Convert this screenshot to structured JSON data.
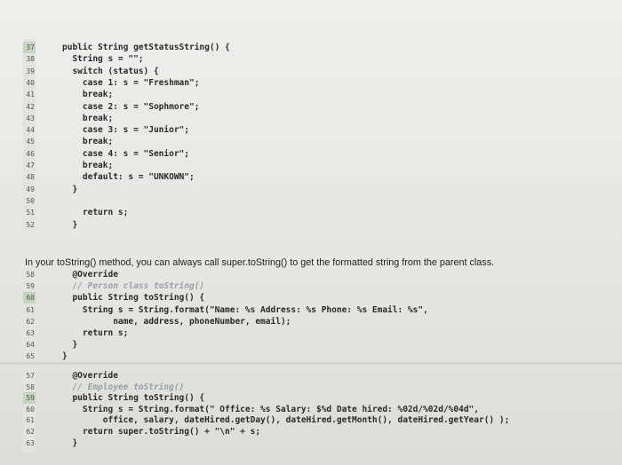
{
  "caption": "In your toString() method, you can always call super.toString() to get the formatted string from the parent class.",
  "block1": [
    {
      "n": "37",
      "code": "public String getStatusString() {"
    },
    {
      "n": "38",
      "code": "  String s = \"\";"
    },
    {
      "n": "39",
      "code": "  switch (status) {"
    },
    {
      "n": "40",
      "code": "    case 1: s = \"Freshman\";"
    },
    {
      "n": "41",
      "code": "    break;"
    },
    {
      "n": "42",
      "code": "    case 2: s = \"Sophmore\";"
    },
    {
      "n": "43",
      "code": "    break;"
    },
    {
      "n": "44",
      "code": "    case 3: s = \"Junior\";"
    },
    {
      "n": "45",
      "code": "    break;"
    },
    {
      "n": "46",
      "code": "    case 4: s = \"Senior\";"
    },
    {
      "n": "47",
      "code": "    break;"
    },
    {
      "n": "48",
      "code": "    default: s = \"UNKOWN\";"
    },
    {
      "n": "49",
      "code": "  }"
    },
    {
      "n": "50",
      "code": ""
    },
    {
      "n": "51",
      "code": "    return s;"
    },
    {
      "n": "52",
      "code": "  }"
    }
  ],
  "block2": [
    {
      "n": "58",
      "code": "  @Override"
    },
    {
      "n": "59",
      "code": "  // Person class toString()"
    },
    {
      "n": "60",
      "code": "  public String toString() {"
    },
    {
      "n": "61",
      "code": "    String s = String.format(\"Name: %s Address: %s Phone: %s Email: %s\","
    },
    {
      "n": "62",
      "code": "          name, address, phoneNumber, email);"
    },
    {
      "n": "63",
      "code": "    return s;"
    },
    {
      "n": "64",
      "code": "  }"
    },
    {
      "n": "65",
      "code": "}"
    }
  ],
  "block3": [
    {
      "n": "57",
      "code": "  @Override"
    },
    {
      "n": "58",
      "code": "  // Employee toString()"
    },
    {
      "n": "59",
      "code": "  public String toString() {"
    },
    {
      "n": "60",
      "code": "    String s = String.format(\" Office: %s Salary: $%d Date hired: %02d/%02d/%04d\","
    },
    {
      "n": "61",
      "code": "        office, salary, dateHired.getDay(), dateHired.getMonth(), dateHired.getYear() );"
    },
    {
      "n": "62",
      "code": "    return super.toString() + \"\\n\" + s;"
    },
    {
      "n": "63",
      "code": "  }"
    }
  ]
}
